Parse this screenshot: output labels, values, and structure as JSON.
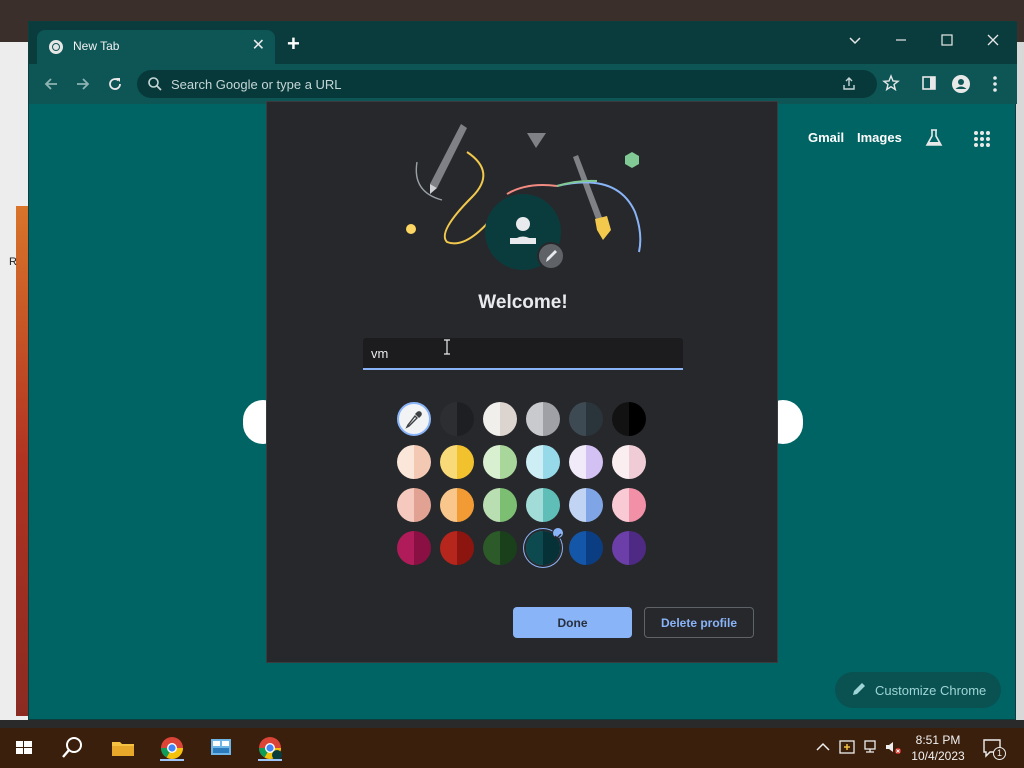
{
  "desktop": {
    "side_letter": "R"
  },
  "browser": {
    "tab_title": "New Tab",
    "tab_close": "✕",
    "new_tab": "+",
    "omnibox_placeholder": "Search Google or type a URL",
    "links": {
      "gmail": "Gmail",
      "images": "Images"
    },
    "customize_label": "Customize Chrome"
  },
  "dialog": {
    "welcome": "Welcome!",
    "name_value": "vm",
    "done_label": "Done",
    "delete_label": "Delete profile",
    "swatches": [
      [
        "eyedropper",
        "#2d2e31|#1e1f22",
        "#f1efec|#dcd5cf",
        "#c9cacd|#9fa1a6",
        "#3e4a53|#2a343b",
        "#121212|#000000"
      ],
      [
        "#fbe6da|#f4c9b3",
        "#f9da78|#f2c12e",
        "#d8efd0|#a9d79b",
        "#cdeef5|#96d9e8",
        "#f1eaf9|#d2c1f2",
        "#fbeef1|#f0ccd6"
      ],
      [
        "#f5c9bd|#e2a293",
        "#f9c68b|#f29b34",
        "#b9deb1|#7cbf73",
        "#a2dcd9|#5fbeb8",
        "#c1d4f4|#7fa5e6",
        "#f9c9d4|#f190a7"
      ],
      [
        "#b01c59|#8a0f43",
        "#b7261c|#8c150f",
        "#2c5a28|#19401a",
        "#0d4a4f|#063136",
        "#1456a8|#0b3d82",
        "#6b3ea8|#4f2a85"
      ]
    ],
    "selected_swatch": [
      3,
      3
    ],
    "accent": "#8ab4f8"
  },
  "taskbar": {
    "time": "8:51 PM",
    "date": "10/4/2023",
    "notification_count": "1"
  }
}
